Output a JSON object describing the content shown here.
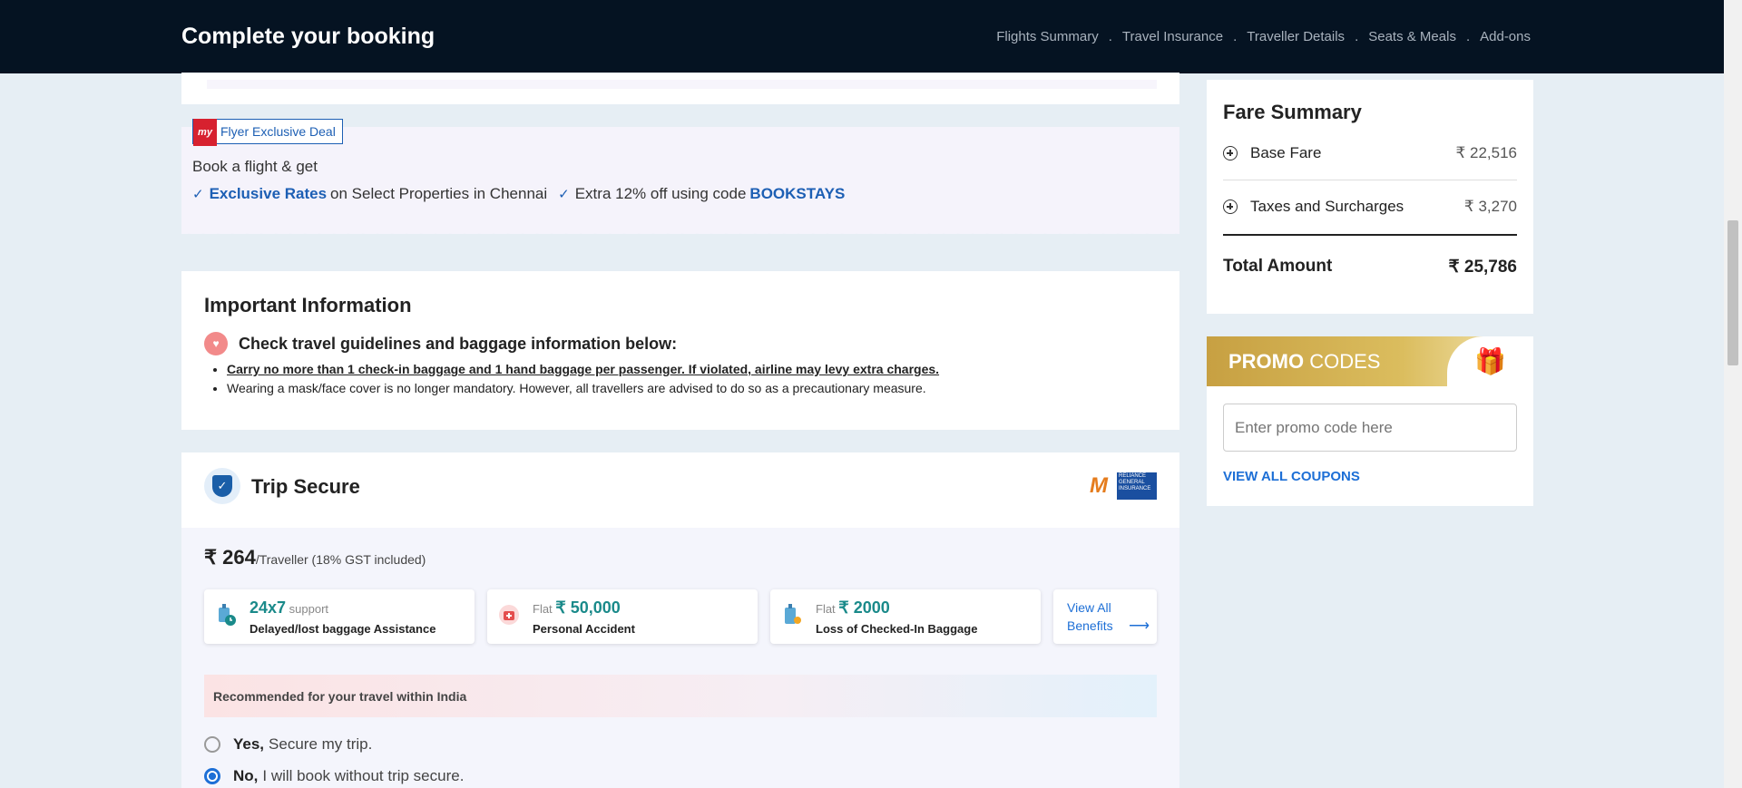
{
  "header": {
    "title": "Complete your booking",
    "nav": [
      "Flights Summary",
      "Travel Insurance",
      "Traveller Details",
      "Seats & Meals",
      "Add-ons"
    ],
    "separator": "."
  },
  "deal": {
    "badge": "Flyer Exclusive Deal",
    "logo": "my",
    "line1": "Book a flight & get",
    "item1_bold": "Exclusive Rates",
    "item1_rest": "on Select Properties in Chennai",
    "item2_text": "Extra 12% off using code",
    "item2_code": "BOOKSTAYS"
  },
  "info": {
    "title": "Important Information",
    "subtitle": "Check travel guidelines and baggage information below:",
    "bullets": [
      "Carry no more than 1 check-in baggage and 1 hand baggage per passenger. If violated, airline may levy extra charges.",
      "Wearing a mask/face cover is no longer mandatory. However, all travellers are advised to do so as a precautionary measure."
    ]
  },
  "trip": {
    "title": "Trip Secure",
    "insurer_text": "RELIANCE GENERAL INSURANCE",
    "price": "₹ 264",
    "price_suffix": "/Traveller (18% GST included)",
    "benefits": [
      {
        "prefix": "",
        "value": "24x7",
        "suffix": "support",
        "label": "Delayed/lost baggage Assistance"
      },
      {
        "prefix": "Flat",
        "value": "₹ 50,000",
        "suffix": "",
        "label": "Personal Accident"
      },
      {
        "prefix": "Flat",
        "value": "₹ 2000",
        "suffix": "",
        "label": "Loss of Checked-In Baggage"
      }
    ],
    "view_all": "View All Benefits",
    "recommend": "Recommended for your travel within India",
    "options": [
      {
        "bold": "Yes,",
        "text": "Secure my trip.",
        "selected": false
      },
      {
        "bold": "No,",
        "text": "I will book without trip secure.",
        "selected": true
      }
    ]
  },
  "fare": {
    "title": "Fare Summary",
    "rows": [
      {
        "label": "Base Fare",
        "value": "₹ 22,516"
      },
      {
        "label": "Taxes and Surcharges",
        "value": "₹ 3,270"
      }
    ],
    "total_label": "Total Amount",
    "total_value": "₹ 25,786"
  },
  "promo": {
    "title_bold": "PROMO",
    "title_rest": "CODES",
    "placeholder": "Enter promo code here",
    "link": "VIEW ALL COUPONS"
  },
  "colors": {
    "header_bg": "#051322",
    "accent_blue": "#1d6fd6",
    "deal_blue": "#1d5fb4",
    "teal": "#1a8a8a"
  }
}
